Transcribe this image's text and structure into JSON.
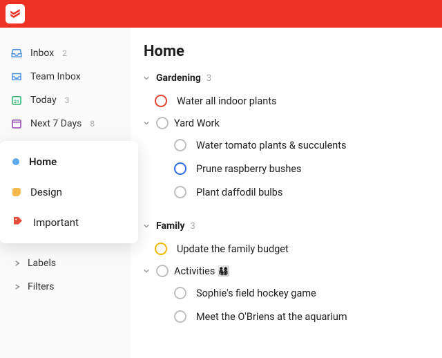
{
  "colors": {
    "brand": "#ee3224",
    "home_dot": "#5fa8ee",
    "design_dot": "#f3b94a",
    "tag_red": "#e74c3c"
  },
  "nav": {
    "inbox": {
      "label": "Inbox",
      "count": "2",
      "icon": "inbox-icon"
    },
    "team_inbox": {
      "label": "Team Inbox",
      "icon": "team-inbox-icon"
    },
    "today": {
      "label": "Today",
      "count": "3",
      "icon": "today-icon"
    },
    "next7": {
      "label": "Next 7 Days",
      "count": "8",
      "icon": "calendar-icon"
    }
  },
  "projects": [
    {
      "key": "home",
      "label": "Home",
      "dot": "#5fa8ee",
      "active": true
    },
    {
      "key": "design",
      "label": "Design",
      "dot": "#f3b94a"
    },
    {
      "key": "important",
      "label": "Important",
      "tag": true
    }
  ],
  "collapsibles": {
    "labels": "Labels",
    "filters": "Filters"
  },
  "page": {
    "title": "Home"
  },
  "sections": [
    {
      "title": "Gardening",
      "count": "3",
      "items": [
        {
          "text": "Water all indoor plants",
          "priority": "red"
        },
        {
          "text": "Yard Work",
          "parent": true,
          "children": [
            {
              "text": "Water tomato plants & succulents"
            },
            {
              "text": "Prune raspberry bushes",
              "priority": "blue"
            },
            {
              "text": "Plant daffodil bulbs"
            }
          ]
        }
      ]
    },
    {
      "title": "Family",
      "count": "3",
      "items": [
        {
          "text": "Update the family budget",
          "priority": "yellow"
        },
        {
          "text": "Activities 👨‍👩‍👧‍👦",
          "parent": true,
          "children": [
            {
              "text": "Sophie's field hockey game"
            },
            {
              "text": "Meet the O'Briens at the aquarium"
            }
          ]
        }
      ]
    }
  ]
}
